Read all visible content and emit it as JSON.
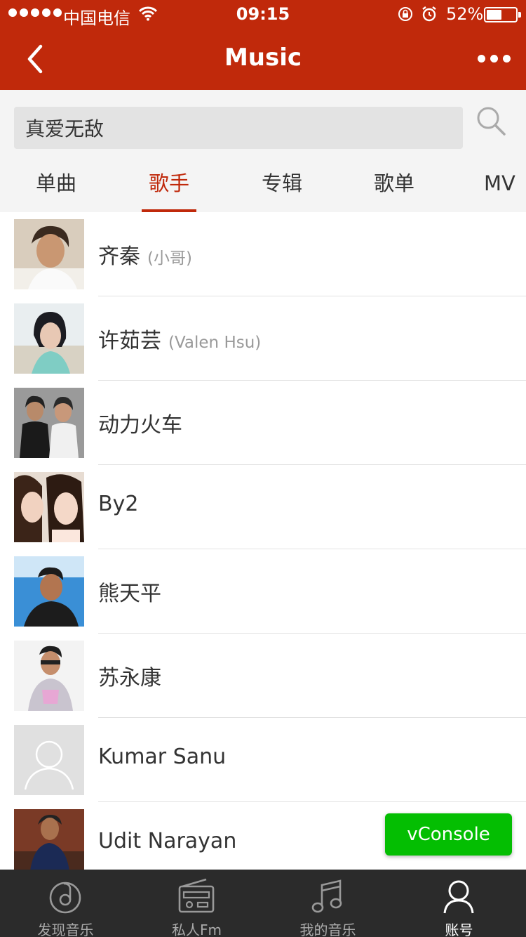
{
  "status_bar": {
    "carrier": "中国电信",
    "time": "09:15",
    "battery_percent": "52%",
    "battery_level": 0.52
  },
  "header": {
    "title": "Music",
    "back_icon": "chevron-left-icon",
    "more_icon": "more-dots-icon"
  },
  "search": {
    "value": "真爱无敌",
    "icon": "search-icon"
  },
  "tabs": [
    {
      "label": "单曲",
      "active": false
    },
    {
      "label": "歌手",
      "active": true
    },
    {
      "label": "专辑",
      "active": false
    },
    {
      "label": "歌单",
      "active": false
    },
    {
      "label": "MV",
      "active": false
    }
  ],
  "artists": [
    {
      "name": "齐秦",
      "alias": "(小哥)"
    },
    {
      "name": "许茹芸",
      "alias": "(Valen Hsu)"
    },
    {
      "name": "动力火车",
      "alias": ""
    },
    {
      "name": "By2",
      "alias": ""
    },
    {
      "name": "熊天平",
      "alias": ""
    },
    {
      "name": "苏永康",
      "alias": ""
    },
    {
      "name": "Kumar Sanu",
      "alias": ""
    },
    {
      "name": "Udit Narayan",
      "alias": ""
    }
  ],
  "vconsole": {
    "label": "vConsole"
  },
  "bottom_nav": [
    {
      "label": "发现音乐",
      "icon": "discover-music-icon",
      "active": false
    },
    {
      "label": "私人Fm",
      "icon": "radio-icon",
      "active": false
    },
    {
      "label": "我的音乐",
      "icon": "music-note-icon",
      "active": false
    },
    {
      "label": "账号",
      "icon": "account-icon",
      "active": true
    }
  ],
  "colors": {
    "brand": "#c0290b",
    "vconsole": "#04be02",
    "nav_bg": "#2b2b2b"
  }
}
